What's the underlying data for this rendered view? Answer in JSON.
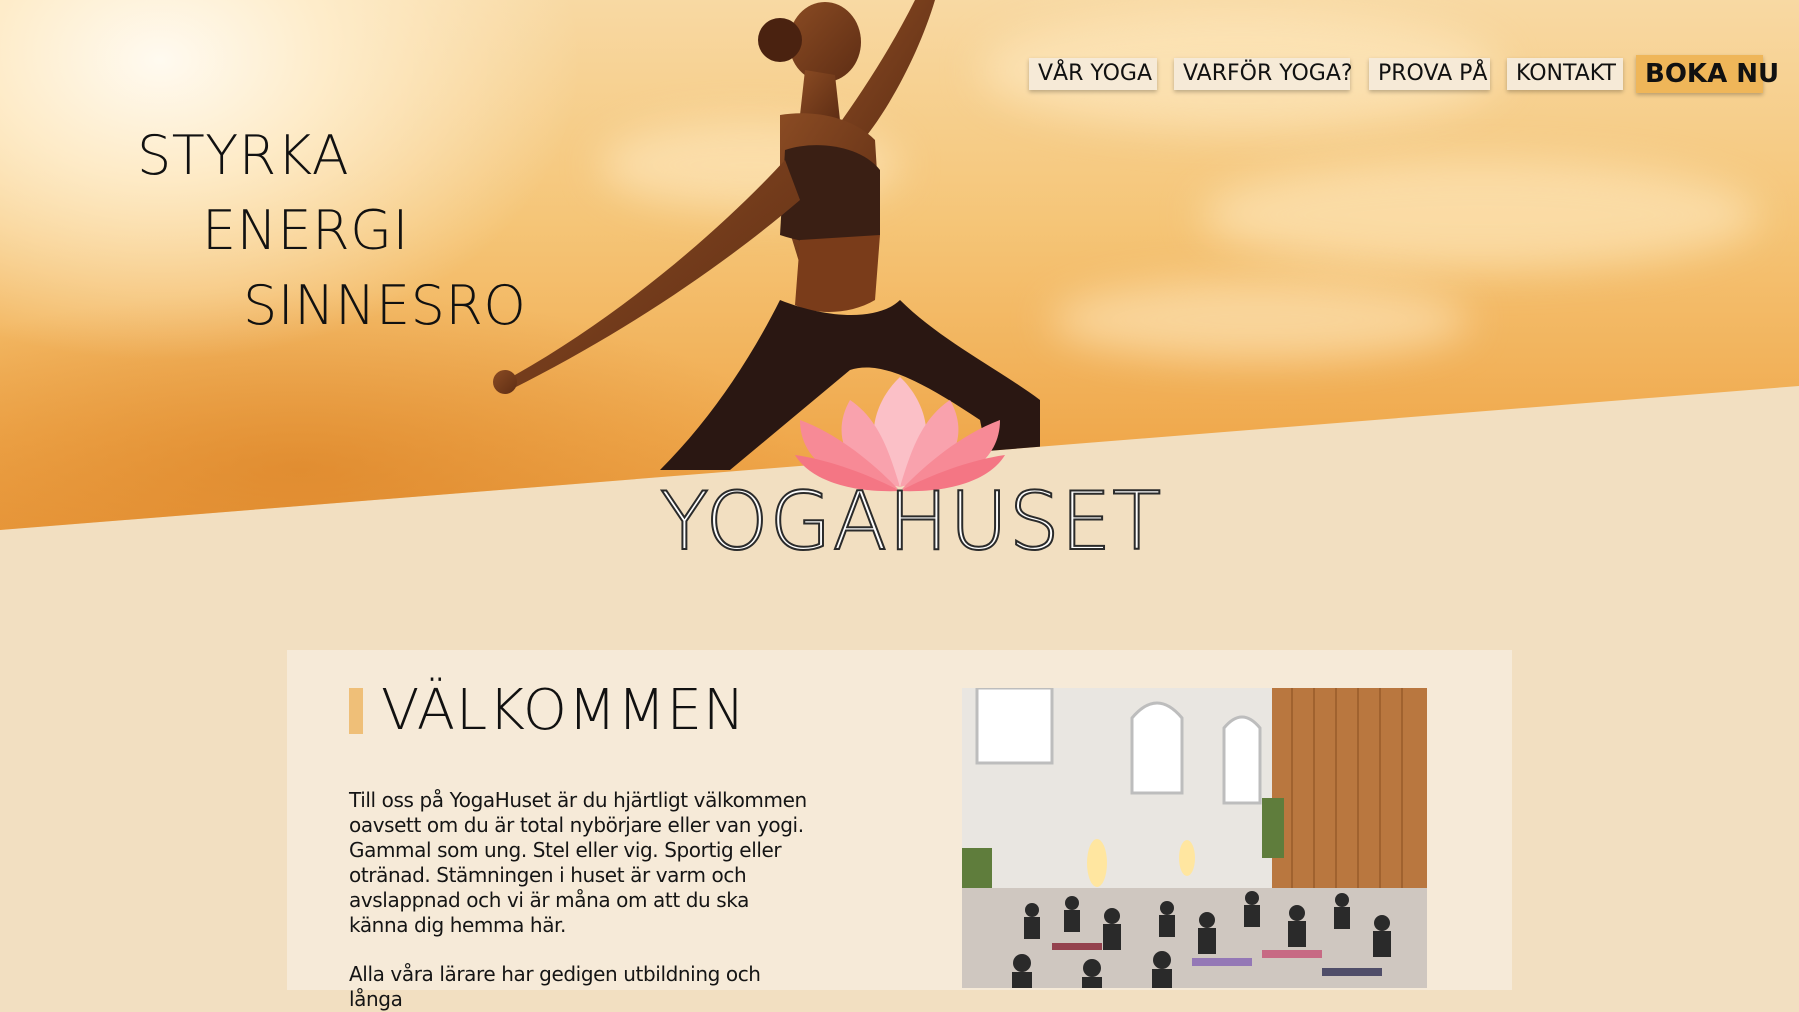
{
  "nav": {
    "items": [
      "VÅR YOGA",
      "VARFÖR YOGA?",
      "PROVA PÅ",
      "KONTAKT"
    ],
    "cta": "BOKA NU"
  },
  "hero": {
    "slogan": [
      "STYRKA",
      "ENERGI",
      "SINNESRO"
    ],
    "image": "yoga-woman-sunset-photo"
  },
  "brand": {
    "name": "YOGAHUSET",
    "icon": "lotus-icon"
  },
  "welcome": {
    "title": "VÄLKOMMEN",
    "paragraph1": "Till oss på YogaHuset är du hjärtligt välkommen oavsett om du är total nybörjare eller van yogi. Gammal som ung. Stel eller vig. Sportig eller otränad. Stämningen i huset är varm och avslappnad och vi är måna om att du ska känna dig hemma här.",
    "paragraph2": "Alla våra lärare har gedigen utbildning och långa",
    "image": "yoga-class-studio-photo"
  },
  "colors": {
    "accent": "#efb659",
    "page_bg": "#f2dfc1",
    "card_bg": "#f6ead8",
    "lotus": "#f78a96"
  }
}
